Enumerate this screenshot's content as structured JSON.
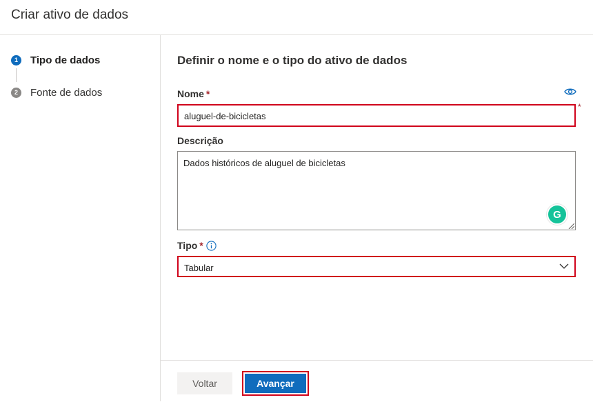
{
  "header": {
    "title": "Criar ativo de dados"
  },
  "steps": [
    {
      "number": "1",
      "label": "Tipo de dados"
    },
    {
      "number": "2",
      "label": "Fonte de dados"
    }
  ],
  "main": {
    "heading": "Definir o nome e o tipo do ativo de dados",
    "name": {
      "label": "Nome",
      "required_mark": "*",
      "value": "aluguel-de-bicicletas"
    },
    "description": {
      "label": "Descrição",
      "value": "Dados históricos de aluguel de bicicletas"
    },
    "type": {
      "label": "Tipo",
      "required_mark": "*",
      "value": "Tabular"
    },
    "grammarly_letter": "G"
  },
  "footer": {
    "back_label": "Voltar",
    "next_label": "Avançar"
  },
  "colors": {
    "primary": "#0f6cbd",
    "highlight_border": "#d0021b",
    "required": "#a4262c"
  },
  "icons": [
    "eye-icon",
    "info-icon",
    "chevron-down-icon",
    "grammarly-icon",
    "resize-grip-icon"
  ]
}
